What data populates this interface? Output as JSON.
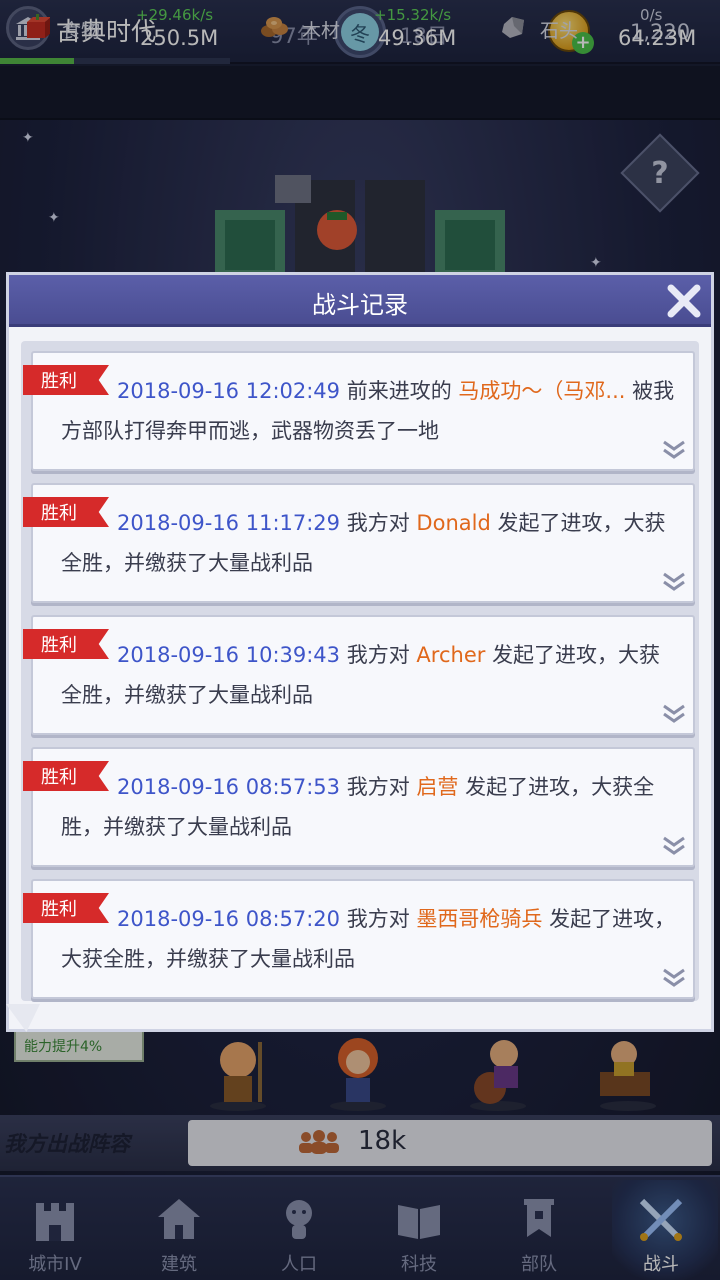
{
  "header": {
    "era_title": "古典时代",
    "year": "97年",
    "season": "冬",
    "day": "18日",
    "coins": "1,220",
    "era_progress": 0.32
  },
  "resources": [
    {
      "name": "食物",
      "rate": "+29.46k/s",
      "amount": "250.5M",
      "icon": "food-icon"
    },
    {
      "name": "木材",
      "rate": "+15.32k/s",
      "amount": "49.36M",
      "icon": "wood-icon"
    },
    {
      "name": "石头",
      "rate": "0/s",
      "amount": "64.23M",
      "icon": "stone-icon"
    }
  ],
  "modal": {
    "title": "战斗记录",
    "entries": [
      {
        "result": "胜利",
        "timestamp": "2018-09-16 12:02:49",
        "pre": "前来进攻的",
        "enemy": "马成功～（马邓...",
        "post": "被我方部队打得奔甲而逃，武器物资丢了一地"
      },
      {
        "result": "胜利",
        "timestamp": "2018-09-16 11:17:29",
        "pre": "我方对",
        "enemy": "Donald",
        "post": "发起了进攻，大获全胜，并缴获了大量战利品"
      },
      {
        "result": "胜利",
        "timestamp": "2018-09-16 10:39:43",
        "pre": "我方对",
        "enemy": "Archer",
        "post": "发起了进攻，大获全胜，并缴获了大量战利品"
      },
      {
        "result": "胜利",
        "timestamp": "2018-09-16 08:57:53",
        "pre": "我方对",
        "enemy": "启营",
        "post": "发起了进攻，大获全胜，并缴获了大量战利品"
      },
      {
        "result": "胜利",
        "timestamp": "2018-09-16 08:57:20",
        "pre": "我方对",
        "enemy": "墨西哥枪骑兵",
        "post": "发起了进攻，大获全胜，并缴获了大量战利品"
      }
    ]
  },
  "lineup": {
    "boost": "能力提升4%",
    "label": "我方出战阵容",
    "power": "18k"
  },
  "nav": [
    {
      "label": "城市IV",
      "icon": "castle-icon"
    },
    {
      "label": "建筑",
      "icon": "house-icon"
    },
    {
      "label": "人口",
      "icon": "person-icon"
    },
    {
      "label": "科技",
      "icon": "book-icon"
    },
    {
      "label": "部队",
      "icon": "banner-icon"
    },
    {
      "label": "战斗",
      "icon": "crossed-swords-icon"
    }
  ],
  "colors": {
    "accent_header": "#4a4d92",
    "victory_red": "#d62a2a",
    "timestamp_blue": "#3e55c9",
    "enemy_orange": "#e0681c",
    "rate_green": "#5fd35a"
  }
}
